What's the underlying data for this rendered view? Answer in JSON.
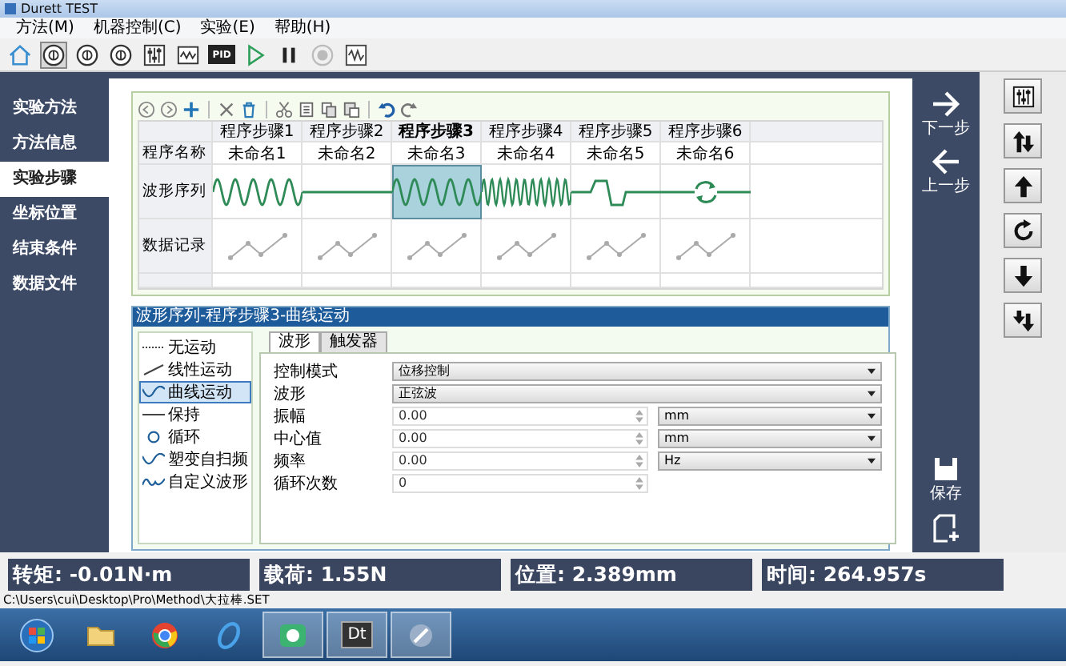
{
  "window": {
    "title": "Durett TEST"
  },
  "menu": [
    "方法(M)",
    "机器控制(C)",
    "实验(E)",
    "帮助(H)"
  ],
  "toolbar": [
    {
      "kind": "home",
      "pressed": false
    },
    {
      "kind": "dial",
      "pressed": true
    },
    {
      "kind": "dial",
      "pressed": false
    },
    {
      "kind": "dial",
      "pressed": false
    },
    {
      "kind": "sliders",
      "pressed": false
    },
    {
      "kind": "wave",
      "pressed": false
    },
    {
      "kind": "pid",
      "label": "PID",
      "pressed": false
    },
    {
      "kind": "play",
      "pressed": false
    },
    {
      "kind": "pause",
      "pressed": false
    },
    {
      "kind": "stop",
      "pressed": false
    },
    {
      "kind": "wavebox",
      "pressed": false
    }
  ],
  "sidebar": [
    {
      "label": "实验方法",
      "selected": false
    },
    {
      "label": "方法信息",
      "selected": false
    },
    {
      "label": "实验步骤",
      "selected": true
    },
    {
      "label": "坐标位置",
      "selected": false
    },
    {
      "label": "结束条件",
      "selected": false
    },
    {
      "label": "数据文件",
      "selected": false
    }
  ],
  "grid": {
    "row_labels": [
      "程序名称",
      "波形序列",
      "数据记录"
    ],
    "steps": [
      {
        "label": "程序步骤1",
        "name": "未命名1",
        "kind": "sine",
        "selected": false
      },
      {
        "label": "程序步骤2",
        "name": "未命名2",
        "kind": "flat",
        "selected": false
      },
      {
        "label": "程序步骤3",
        "name": "未命名3",
        "kind": "sine",
        "selected": true
      },
      {
        "label": "程序步骤4",
        "name": "未命名4",
        "kind": "dense",
        "selected": false
      },
      {
        "label": "程序步骤5",
        "name": "未命名5",
        "kind": "pulse",
        "selected": false
      },
      {
        "label": "程序步骤6",
        "name": "未命名6",
        "kind": "cycle",
        "selected": false
      }
    ]
  },
  "editor": {
    "title": "波形序列-程序步骤3-曲线运动",
    "motions": [
      {
        "label": "无运动",
        "kind": "none",
        "selected": false
      },
      {
        "label": "线性运动",
        "kind": "linear",
        "selected": false
      },
      {
        "label": "曲线运动",
        "kind": "curve",
        "selected": true
      },
      {
        "label": "保持",
        "kind": "hold",
        "selected": false
      },
      {
        "label": "循环",
        "kind": "loop",
        "selected": false
      },
      {
        "label": "塑变自扫频",
        "kind": "sweep",
        "selected": false
      },
      {
        "label": "自定义波形",
        "kind": "custom",
        "selected": false
      }
    ],
    "tabs": [
      {
        "label": "波形",
        "selected": true
      },
      {
        "label": "触发器",
        "selected": false
      }
    ],
    "fields": [
      {
        "label": "控制模式",
        "kind": "dropdown",
        "value": "位移控制"
      },
      {
        "label": "波形",
        "kind": "dropdown",
        "value": "正弦波"
      },
      {
        "label": "振幅",
        "kind": "spin",
        "value": "0.00",
        "unit": "mm"
      },
      {
        "label": "中心值",
        "kind": "spin",
        "value": "0.00",
        "unit": "mm"
      },
      {
        "label": "频率",
        "kind": "spin",
        "value": "0.00",
        "unit": "Hz"
      },
      {
        "label": "循环次数",
        "kind": "spin",
        "value": "0"
      }
    ]
  },
  "nav": [
    {
      "kind": "next",
      "label": "下一步"
    },
    {
      "kind": "prev",
      "label": "上一步"
    }
  ],
  "file_actions": [
    {
      "kind": "save",
      "label": "保存"
    },
    {
      "kind": "new"
    }
  ],
  "status": [
    "转矩: -0.01N·m",
    "载荷: 1.55N",
    "位置: 2.389mm",
    "时间: 264.957s"
  ],
  "path": "C:\\Users\\cui\\Desktop\\Pro\\Method\\大拉棒.SET",
  "taskbar": [
    {
      "kind": "start",
      "active": false
    },
    {
      "kind": "folder",
      "active": false
    },
    {
      "kind": "browser",
      "active": false
    },
    {
      "kind": "globe",
      "active": false
    },
    {
      "kind": "app",
      "active": true
    },
    {
      "kind": "text",
      "label": "Dt",
      "active": true
    },
    {
      "kind": "tool",
      "active": true
    }
  ]
}
